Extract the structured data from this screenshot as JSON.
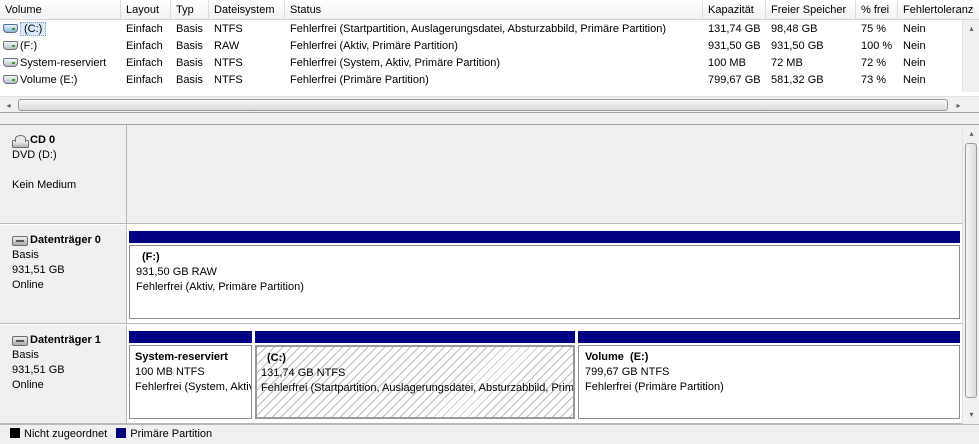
{
  "volume_list": {
    "columns": [
      "Volume",
      "Layout",
      "Typ",
      "Dateisystem",
      "Status",
      "Kapazität",
      "Freier Speicher",
      "% frei",
      "Fehlertoleranz"
    ],
    "rows": [
      {
        "volume": "(C:)",
        "layout": "Einfach",
        "typ": "Basis",
        "fs": "NTFS",
        "status": "Fehlerfrei (Startpartition, Auslagerungsdatei, Absturzabbild, Primäre Partition)",
        "kapazitaet": "131,74 GB",
        "frei": "98,48 GB",
        "pct": "75 %",
        "ft": "Nein"
      },
      {
        "volume": "(F:)",
        "layout": "Einfach",
        "typ": "Basis",
        "fs": "RAW",
        "status": "Fehlerfrei (Aktiv, Primäre Partition)",
        "kapazitaet": "931,50 GB",
        "frei": "931,50 GB",
        "pct": "100 %",
        "ft": "Nein"
      },
      {
        "volume": "System-reserviert",
        "layout": "Einfach",
        "typ": "Basis",
        "fs": "NTFS",
        "status": "Fehlerfrei (System, Aktiv, Primäre Partition)",
        "kapazitaet": "100 MB",
        "frei": "72 MB",
        "pct": "72 %",
        "ft": "Nein"
      },
      {
        "volume": "Volume (E:)",
        "layout": "Einfach",
        "typ": "Basis",
        "fs": "NTFS",
        "status": "Fehlerfrei (Primäre Partition)",
        "kapazitaet": "799,67 GB",
        "frei": "581,32 GB",
        "pct": "73 %",
        "ft": "Nein"
      }
    ]
  },
  "scroll": {
    "left": "◂",
    "right": "▸",
    "up": "▴",
    "down": "▾"
  },
  "disks": {
    "cd0": {
      "name": "CD 0",
      "type": "DVD (D:)",
      "status": "Kein Medium"
    },
    "disk0": {
      "name": "Datenträger 0",
      "type": "Basis",
      "size": "931,51 GB",
      "status": "Online",
      "partitions": [
        {
          "name": "(F:)",
          "size": "931,50 GB RAW",
          "status": "Fehlerfrei (Aktiv, Primäre Partition)"
        }
      ]
    },
    "disk1": {
      "name": "Datenträger 1",
      "type": "Basis",
      "size": "931,51 GB",
      "status": "Online",
      "partitions": [
        {
          "name": "System-reserviert",
          "size": "100 MB NTFS",
          "status": "Fehlerfrei (System, Aktiv, Primäre Partition)"
        },
        {
          "name": "(C:)",
          "size": "131,74 GB NTFS",
          "status": "Fehlerfrei (Startpartition, Auslagerungsdatei, Absturzabbild, Primäre Partition)"
        },
        {
          "name": "Volume  (E:)",
          "size": "799,67 GB NTFS",
          "status": "Fehlerfrei (Primäre Partition)"
        }
      ]
    }
  },
  "legend": {
    "items": [
      {
        "label": "Nicht zugeordnet",
        "color": "#000000"
      },
      {
        "label": "Primäre Partition",
        "color": "#000080"
      }
    ]
  },
  "colors": {
    "primary_partition": "#000080",
    "unallocated": "#000000"
  }
}
